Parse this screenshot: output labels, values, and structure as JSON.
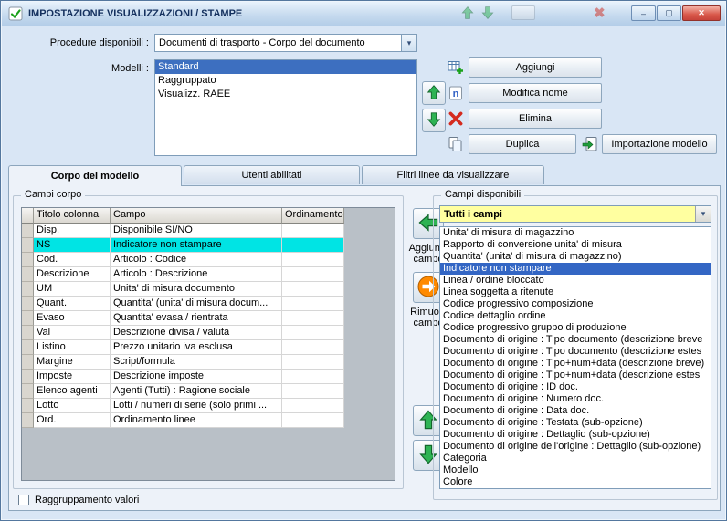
{
  "window": {
    "title": "IMPOSTAZIONE VISUALIZZAZIONI / STAMPE"
  },
  "icons": {
    "minimize": "–",
    "maximize": "▢",
    "close": "✕",
    "combo_arrow": "▾",
    "rename_letter": "n"
  },
  "top": {
    "procedures_label": "Procedure disponibili :",
    "procedures_value": "Documenti di trasporto - Corpo del documento",
    "models_label": "Modelli :",
    "models": [
      "Standard",
      "Raggruppato",
      "Visualizz. RAEE"
    ],
    "selected_model": "Standard",
    "actions": {
      "add": "Aggiungi",
      "rename": "Modifica nome",
      "delete": "Elimina",
      "duplicate": "Duplica",
      "import": "Importazione modello"
    }
  },
  "tabs": [
    {
      "label": "Corpo del modello",
      "active": true
    },
    {
      "label": "Utenti abilitati",
      "active": false
    },
    {
      "label": "Filtri linee da visualizzare",
      "active": false
    }
  ],
  "body_tab": {
    "group_label": "Campi corpo",
    "columns": [
      "Titolo colonna",
      "Campo",
      "Ordinamento"
    ],
    "rows": [
      [
        "Disp.",
        "Disponibile SI/NO",
        ""
      ],
      [
        "NS",
        "Indicatore non stampare",
        ""
      ],
      [
        "Cod.",
        "Articolo : Codice",
        ""
      ],
      [
        "Descrizione",
        "Articolo : Descrizione",
        ""
      ],
      [
        "UM",
        "Unita' di misura documento",
        ""
      ],
      [
        "Quant.",
        "Quantita' (unita' di misura docum...",
        ""
      ],
      [
        "Evaso",
        "Quantita' evasa / rientrata",
        ""
      ],
      [
        "Val",
        "Descrizione divisa / valuta",
        ""
      ],
      [
        "Listino",
        "Prezzo unitario iva esclusa",
        ""
      ],
      [
        "Margine",
        "Script/formula",
        ""
      ],
      [
        "Imposte",
        "Descrizione imposte",
        ""
      ],
      [
        "Elenco agenti",
        "Agenti (Tutti) : Ragione sociale",
        ""
      ],
      [
        "Lotto",
        "Lotti / numeri di serie (solo primi ...",
        ""
      ],
      [
        "Ord.",
        "Ordinamento linee",
        ""
      ]
    ],
    "selected_row": "NS",
    "add_field_label": "Aggiungi campo",
    "remove_field_label": "Rimuovi campo",
    "available_label": "Campi disponibili",
    "filter_value": "Tutti i campi",
    "available_items": [
      "Unita' di misura di magazzino",
      "Rapporto di conversione unita' di misura",
      "Quantita' (unita' di misura di magazzino)",
      "Indicatore non stampare",
      "Linea / ordine bloccato",
      "Linea soggetta a ritenute",
      "Codice progressivo composizione",
      "Codice dettaglio ordine",
      "Codice progressivo gruppo di produzione",
      "Documento di origine : Tipo documento (descrizione breve",
      "Documento di origine : Tipo documento (descrizione estes",
      "Documento di origine : Tipo+num+data (descrizione breve)",
      "Documento di origine : Tipo+num+data (descrizione estes",
      "Documento di origine : ID doc.",
      "Documento di origine : Numero doc.",
      "Documento di origine : Data doc.",
      "Documento di origine : Testata (sub-opzione)",
      "Documento di origine : Dettaglio (sub-opzione)",
      "Documento di origine dell'origine : Dettaglio (sub-opzione)",
      "Categoria",
      "Modello",
      "Colore"
    ],
    "selected_available": "Indicatore non stampare",
    "grouping_checkbox_label": "Raggruppamento valori",
    "grouping_checked": false
  },
  "colors": {
    "selection_blue": "#3A6CC4",
    "highlight_cyan": "#00E4E4",
    "filter_yellow": "#FFFFA0",
    "green_arrow": "#2EB353",
    "orange_arrow": "#FF8A00"
  }
}
